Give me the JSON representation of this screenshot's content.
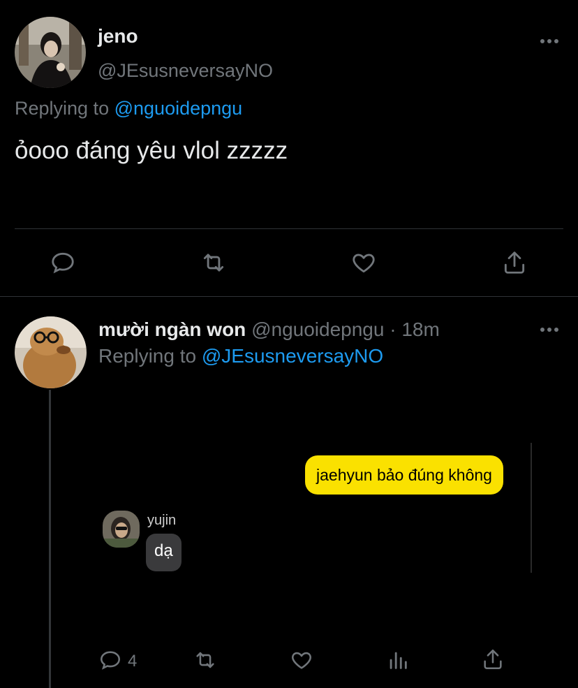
{
  "tweet1": {
    "display_name": "jeno",
    "handle": "@JEsusneversayNO",
    "replying_prefix": "Replying to",
    "replying_handle": "@nguoidepngu",
    "text": "ỏooo đáng yêu vlol zzzzz"
  },
  "tweet2": {
    "display_name": "mười ngàn won",
    "handle": "@nguoidepngu",
    "separator": "·",
    "time": "18m",
    "replying_prefix": "Replying to",
    "replying_handle": "@JEsusneversayNO",
    "chat": {
      "sent_message": "jaehyun bảo đúng không",
      "sender_name": "yujin",
      "received_message": "dạ"
    },
    "reply_count": "4"
  },
  "icons": {
    "more": "more-horizontal-icon",
    "reply": "reply-bubble-icon",
    "retweet": "retweet-icon",
    "like": "heart-icon",
    "share": "share-icon",
    "analytics": "analytics-icon"
  },
  "colors": {
    "background": "#000000",
    "text": "#e7e9ea",
    "muted": "#71767b",
    "link": "#1d9bf0",
    "kakao_yellow": "#fae100",
    "divider": "#2f3336"
  }
}
